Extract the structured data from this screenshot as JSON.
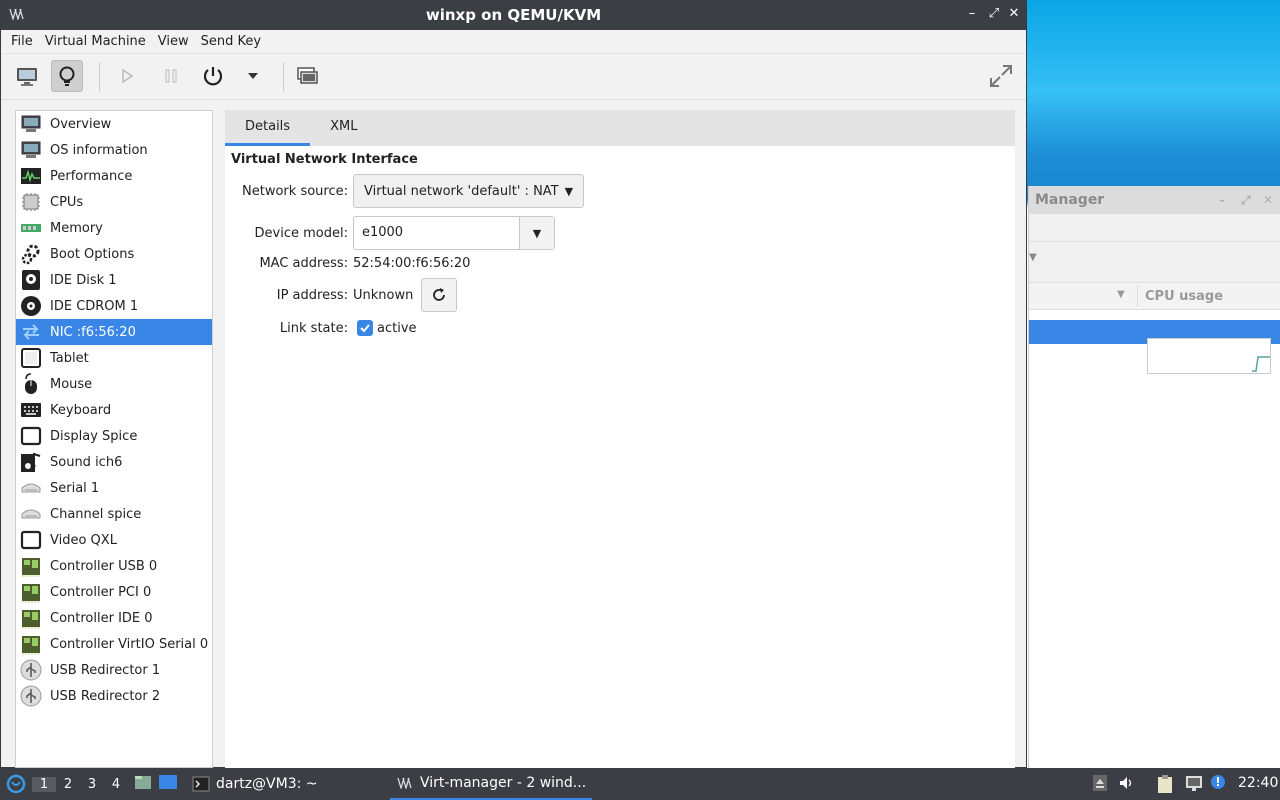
{
  "window": {
    "title": "winxp on QEMU/KVM",
    "controls": {
      "minimize": "–",
      "maximize": "⤢",
      "close": "✕"
    }
  },
  "menubar": [
    "File",
    "Virtual Machine",
    "View",
    "Send Key"
  ],
  "toolbar": {
    "icons": [
      "console-icon",
      "details-icon",
      "run-icon",
      "pause-icon",
      "power-icon",
      "power-menu-icon",
      "snapshots-icon",
      "fullscreen-icon"
    ]
  },
  "sidebar": {
    "items": [
      {
        "label": "Overview",
        "icon": "monitor-icon"
      },
      {
        "label": "OS information",
        "icon": "monitor-icon"
      },
      {
        "label": "Performance",
        "icon": "performance-icon"
      },
      {
        "label": "CPUs",
        "icon": "cpu-icon"
      },
      {
        "label": "Memory",
        "icon": "memory-icon"
      },
      {
        "label": "Boot Options",
        "icon": "gear-icon"
      },
      {
        "label": "IDE Disk 1",
        "icon": "disk-icon"
      },
      {
        "label": "IDE CDROM 1",
        "icon": "cdrom-icon"
      },
      {
        "label": "NIC :f6:56:20",
        "icon": "network-icon",
        "selected": true
      },
      {
        "label": "Tablet",
        "icon": "tablet-icon"
      },
      {
        "label": "Mouse",
        "icon": "mouse-icon"
      },
      {
        "label": "Keyboard",
        "icon": "keyboard-icon"
      },
      {
        "label": "Display Spice",
        "icon": "display-icon"
      },
      {
        "label": "Sound ich6",
        "icon": "sound-icon"
      },
      {
        "label": "Serial 1",
        "icon": "serial-icon"
      },
      {
        "label": "Channel spice",
        "icon": "serial-icon"
      },
      {
        "label": "Video QXL",
        "icon": "display-icon"
      },
      {
        "label": "Controller USB 0",
        "icon": "controller-icon"
      },
      {
        "label": "Controller PCI 0",
        "icon": "controller-icon"
      },
      {
        "label": "Controller IDE 0",
        "icon": "controller-icon"
      },
      {
        "label": "Controller VirtIO Serial 0",
        "icon": "controller-icon"
      },
      {
        "label": "USB Redirector 1",
        "icon": "usb-icon"
      },
      {
        "label": "USB Redirector 2",
        "icon": "usb-icon"
      }
    ]
  },
  "tabs": [
    {
      "label": "Details",
      "active": true
    },
    {
      "label": "XML",
      "active": false
    }
  ],
  "details": {
    "section_title": "Virtual Network Interface",
    "network_source_label": "Network source:",
    "network_source_value": "Virtual network 'default' : NAT",
    "device_model_label": "Device model:",
    "device_model_value": "e1000",
    "mac_label": "MAC address:",
    "mac_value": "52:54:00:f6:56:20",
    "ip_label": "IP address:",
    "ip_value": "Unknown",
    "link_label": "Link state:",
    "link_value": "active",
    "link_checked": true
  },
  "background_window": {
    "title": "Manager",
    "column": "CPU usage"
  },
  "taskbar": {
    "workspaces": [
      "1",
      "2",
      "3",
      "4"
    ],
    "active_workspace": "1",
    "terminal_task": "dartz@VM3: ~",
    "virt_task": "Virt-manager - 2 wind...",
    "clock": "22:40"
  },
  "colors": {
    "accent": "#3a86e6",
    "titlebar": "#3b3e45"
  }
}
